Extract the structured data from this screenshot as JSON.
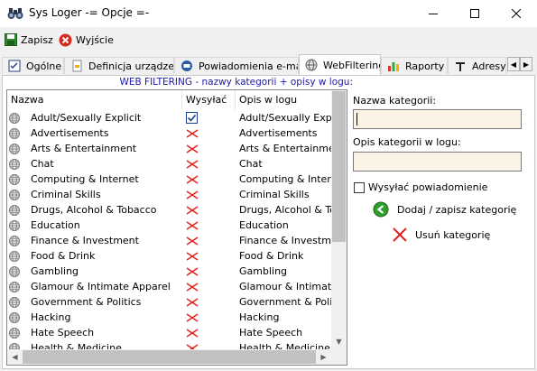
{
  "window": {
    "title": "Sys Loger -= Opcje =-"
  },
  "toolbar": {
    "save_label": "Zapisz",
    "exit_label": "Wyjście"
  },
  "tabs": [
    {
      "label": "Ogólne",
      "icon": "checklist-icon"
    },
    {
      "label": "Definicja urządzeń",
      "icon": "device-icon"
    },
    {
      "label": "Powiadomienia e-mail",
      "icon": "email-icon"
    },
    {
      "label": "WebFiltering",
      "icon": "globe-icon",
      "active": true
    },
    {
      "label": "Raporty",
      "icon": "chart-icon"
    },
    {
      "label": "Adresy",
      "icon": "pin-icon"
    }
  ],
  "webfilter": {
    "caption": "WEB FILTERING - nazwy kategorii + opisy w logu:",
    "columns": {
      "name": "Nazwa",
      "send": "Wysyłać",
      "desc": "Opis w logu"
    },
    "rows": [
      {
        "name": "Adult/Sexually Explicit",
        "send": true,
        "desc": "Adult/Sexually Explicit"
      },
      {
        "name": "Advertisements",
        "send": false,
        "desc": "Advertisements"
      },
      {
        "name": "Arts & Entertainment",
        "send": false,
        "desc": "Arts & Entertainment"
      },
      {
        "name": "Chat",
        "send": false,
        "desc": "Chat"
      },
      {
        "name": "Computing & Internet",
        "send": false,
        "desc": "Computing & Internet"
      },
      {
        "name": "Criminal Skills",
        "send": false,
        "desc": "Criminal Skills"
      },
      {
        "name": "Drugs, Alcohol & Tobacco",
        "send": false,
        "desc": "Drugs, Alcohol & Tobacco"
      },
      {
        "name": "Education",
        "send": false,
        "desc": "Education"
      },
      {
        "name": "Finance & Investment",
        "send": false,
        "desc": "Finance & Investment"
      },
      {
        "name": "Food & Drink",
        "send": false,
        "desc": "Food & Drink"
      },
      {
        "name": "Gambling",
        "send": false,
        "desc": "Gambling"
      },
      {
        "name": "Glamour & Intimate Apparel",
        "send": false,
        "desc": "Glamour & Intimate Apparel"
      },
      {
        "name": "Government & Politics",
        "send": false,
        "desc": "Government & Politics"
      },
      {
        "name": "Hacking",
        "send": false,
        "desc": "Hacking"
      },
      {
        "name": "Hate Speech",
        "send": false,
        "desc": "Hate Speech"
      },
      {
        "name": "Health & Medicine",
        "send": false,
        "desc": "Health & Medicine"
      }
    ]
  },
  "form": {
    "category_name_label": "Nazwa kategorii:",
    "category_name_value": "",
    "log_desc_label": "Opis kategorii w logu:",
    "log_desc_value": "",
    "notify_label": "Wysyłać powiadomienie",
    "notify_checked": false,
    "add_label": "Dodaj / zapisz kategorię",
    "remove_label": "Usuń kategorię"
  },
  "colors": {
    "field_bg": "#fbf4e6",
    "caption": "#1a1aa6",
    "cross": "#e0201c",
    "add_green": "#2e9e2a"
  }
}
